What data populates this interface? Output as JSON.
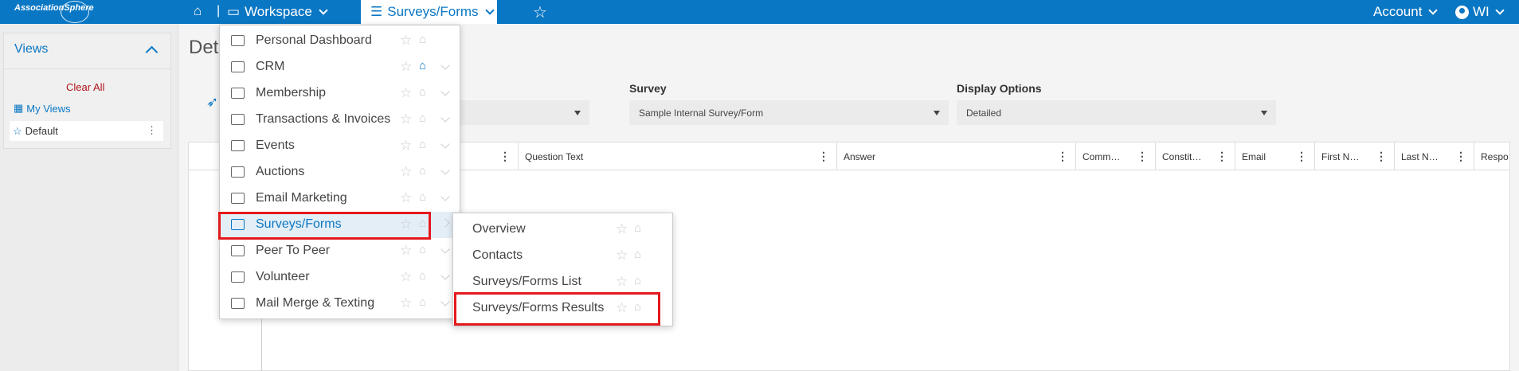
{
  "topbar": {
    "logo": "AssociationSphere",
    "workspace_label": "Workspace",
    "module_label": "Surveys/Forms",
    "account_label": "Account",
    "user_label": "WI",
    "brand_color": "#0a77c4"
  },
  "views": {
    "title": "Views",
    "clear_all": "Clear All",
    "my_views": "My Views",
    "default_label": "Default"
  },
  "page": {
    "title": "Det"
  },
  "filters": {
    "survey_label": "Survey",
    "survey_value": "Sample Internal Survey/Form",
    "display_label": "Display Options",
    "display_value": "Detailed"
  },
  "grid": {
    "columns": [
      "Question Text",
      "Answer",
      "Comm…",
      "Constit…",
      "Email",
      "First N…",
      "Last N…",
      "Respo"
    ]
  },
  "menu": {
    "items": [
      {
        "label": "Personal Dashboard",
        "icon": "dashboard-icon"
      },
      {
        "label": "CRM",
        "icon": "contact-card-icon"
      },
      {
        "label": "Membership",
        "icon": "id-card-icon"
      },
      {
        "label": "Transactions & Invoices",
        "icon": "trend-chart-icon"
      },
      {
        "label": "Events",
        "icon": "ticket-icon"
      },
      {
        "label": "Auctions",
        "icon": "gavel-icon"
      },
      {
        "label": "Email Marketing",
        "icon": "envelope-icon"
      },
      {
        "label": "Surveys/Forms",
        "icon": "list-icon"
      },
      {
        "label": "Peer To Peer",
        "icon": "swap-arrows-icon"
      },
      {
        "label": "Volunteer",
        "icon": "heart-icon"
      },
      {
        "label": "Mail Merge & Texting",
        "icon": "pie-chart-icon"
      }
    ]
  },
  "submenu": {
    "items": [
      {
        "label": "Overview"
      },
      {
        "label": "Contacts"
      },
      {
        "label": "Surveys/Forms List"
      },
      {
        "label": "Surveys/Forms Results"
      }
    ]
  },
  "highlight_color": "#e4191d"
}
